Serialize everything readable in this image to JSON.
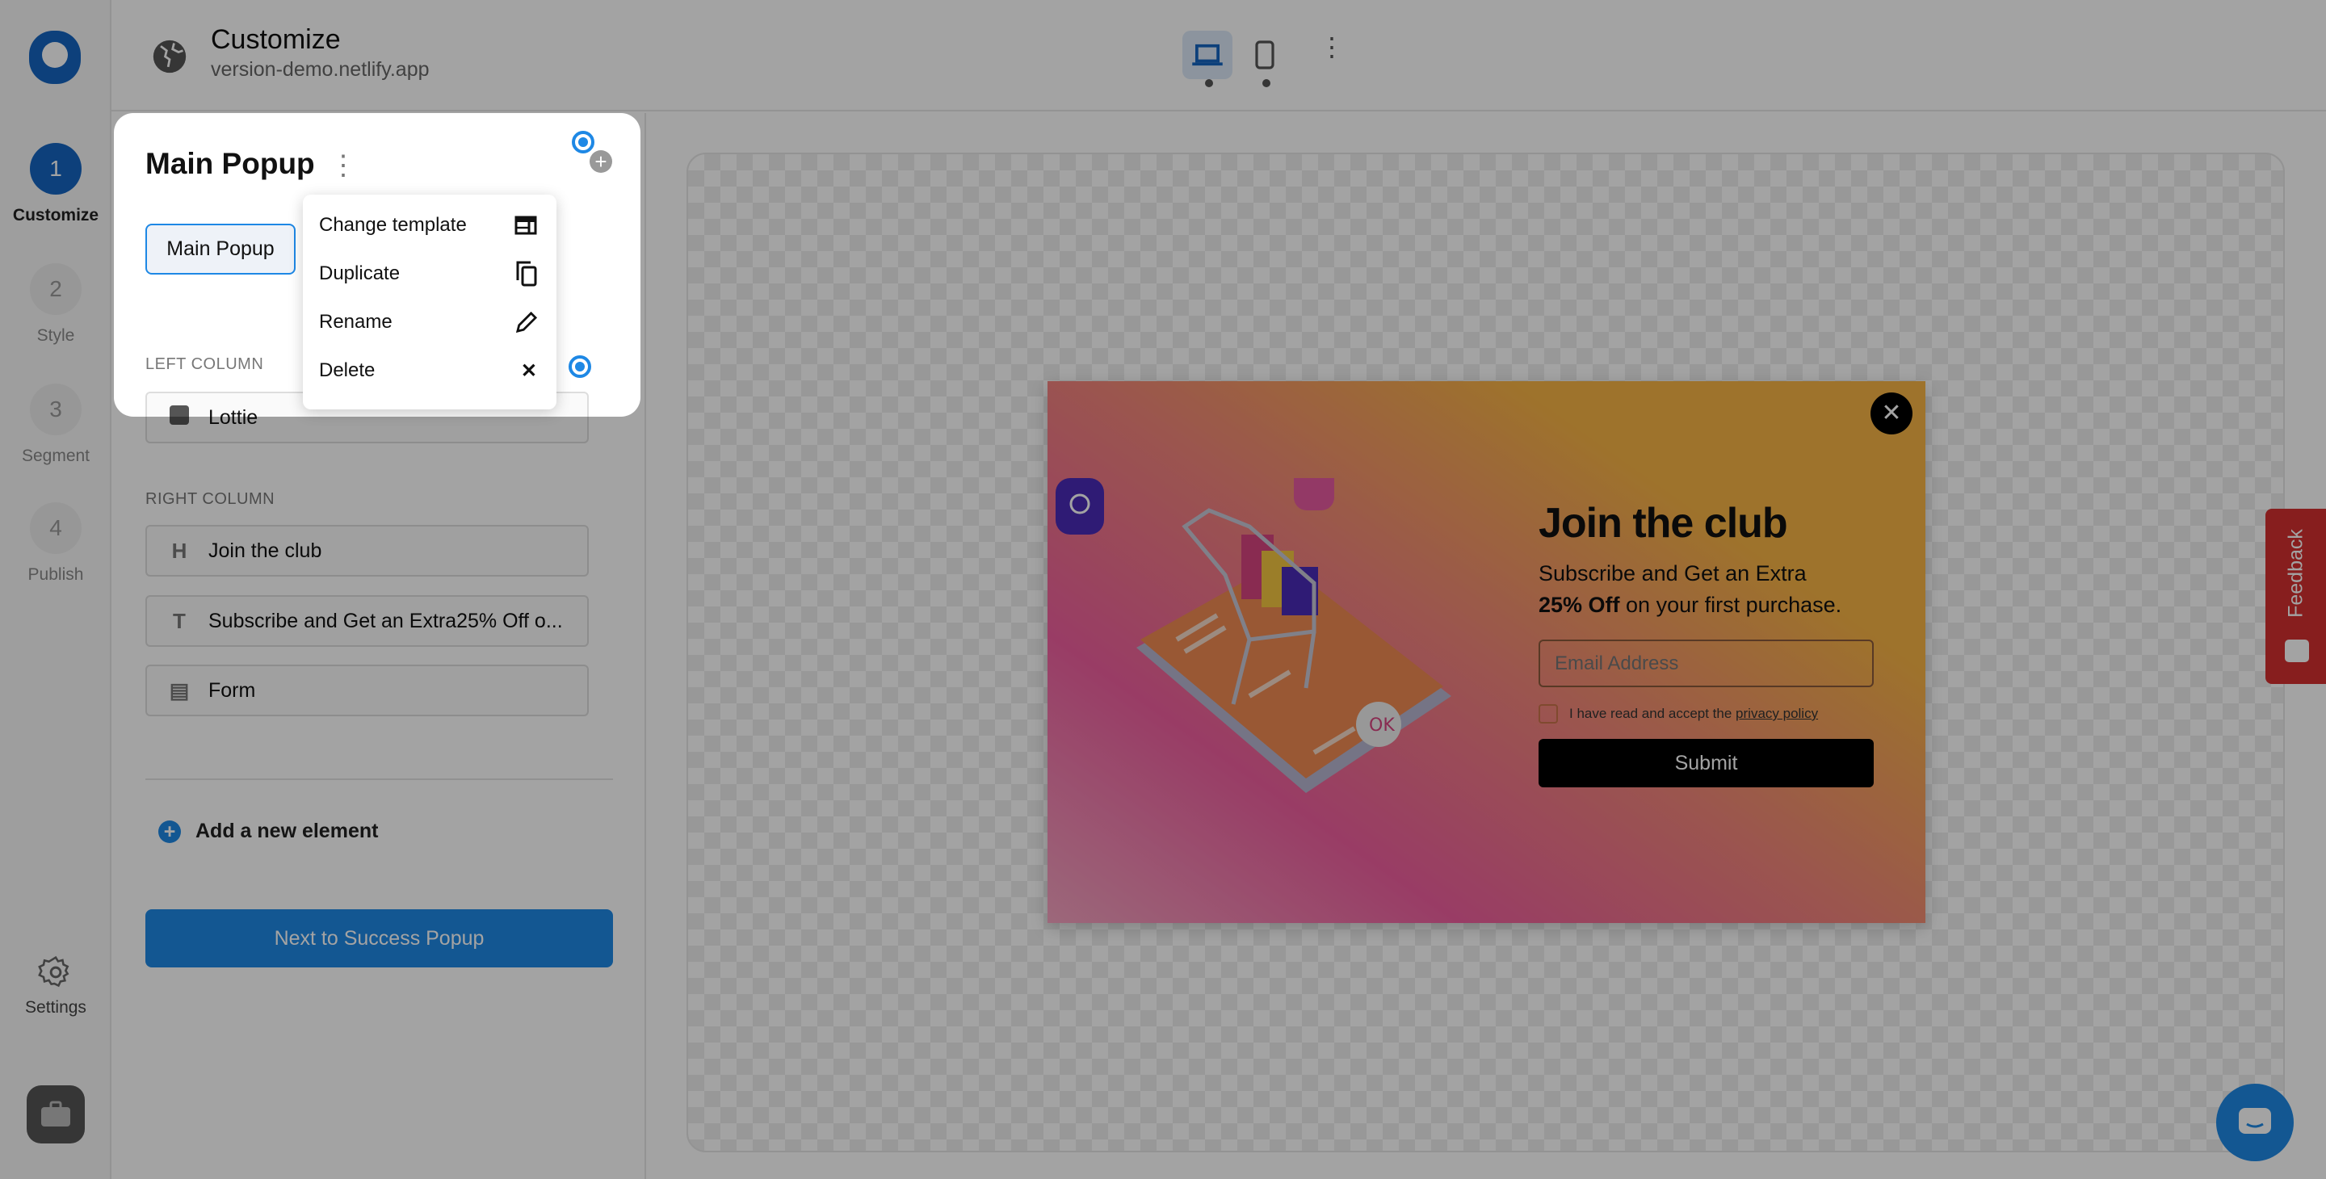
{
  "header": {
    "title": "Customize",
    "subtitle": "version-demo.netlify.app"
  },
  "steps": [
    {
      "num": "1",
      "label": "Customize"
    },
    {
      "num": "2",
      "label": "Style"
    },
    {
      "num": "3",
      "label": "Segment"
    },
    {
      "num": "4",
      "label": "Publish"
    }
  ],
  "rail": {
    "settings": "Settings"
  },
  "panel": {
    "title": "Main Popup",
    "tab": "Main Popup",
    "left_column": "LEFT COLUMN",
    "right_column": "RIGHT COLUMN",
    "left_items": [
      {
        "icon": "lottie-icon",
        "label": "Lottie"
      }
    ],
    "right_items": [
      {
        "icon": "H",
        "label": "Join the club"
      },
      {
        "icon": "T",
        "label": "Subscribe and Get an Extra25% Off o..."
      },
      {
        "icon": "form-icon",
        "label": "Form"
      }
    ],
    "add_element": "Add a new element",
    "next_button": "Next to Success Popup"
  },
  "menu": {
    "items": [
      "Change template",
      "Duplicate",
      "Rename",
      "Delete"
    ]
  },
  "popup": {
    "title": "Join the club",
    "line1": "Subscribe and Get an Extra",
    "bold": "25% Off",
    "line2": " on your first purchase.",
    "email_placeholder": "Email Address",
    "consent": "I have read and accept the ",
    "consent_link": "privacy policy",
    "submit": "Submit",
    "ok_badge": "OK"
  },
  "feedback": "Feedback",
  "colors": {
    "brand": "#1565c0",
    "accent": "#1e88e5",
    "feedback": "#d32f2f"
  }
}
